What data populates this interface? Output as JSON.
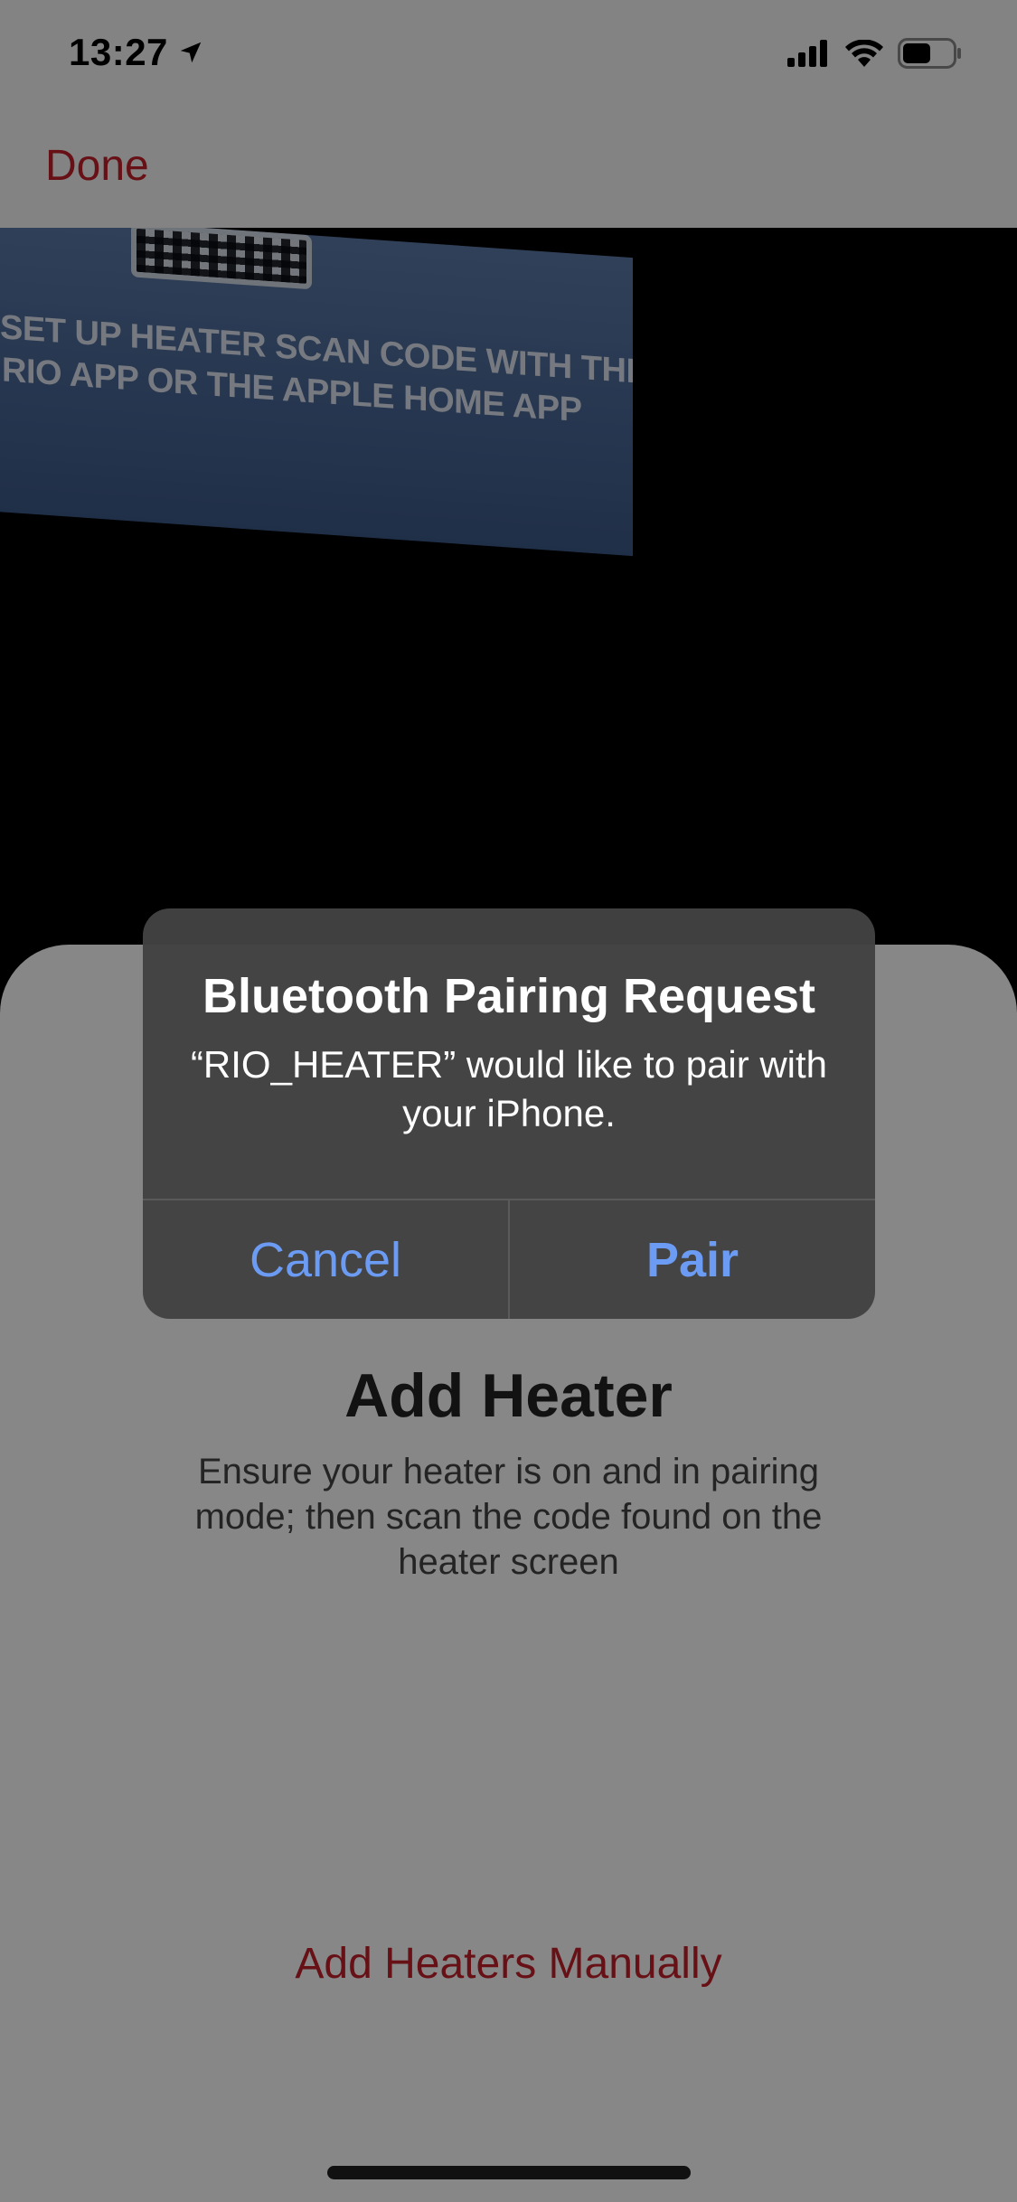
{
  "status_bar": {
    "time": "13:27",
    "location_icon": "location-arrow-icon",
    "signal_icon": "cellular-signal-icon",
    "wifi_icon": "wifi-icon",
    "battery_icon": "battery-icon"
  },
  "nav": {
    "done_label": "Done",
    "accent_color": "#c21f2a"
  },
  "camera_preview": {
    "text_line_1": "SET UP HEATER SCAN CODE WITH THE",
    "text_line_2": "RIO APP OR THE APPLE HOME APP"
  },
  "sheet": {
    "title": "Add Heater",
    "description": "Ensure your heater is on and in pairing mode; then scan the code found on the heater screen",
    "manual_link": "Add Heaters Manually"
  },
  "alert": {
    "title": "Bluetooth Pairing Request",
    "message": "“RIO_HEATER” would like to pair with your iPhone.",
    "cancel_label": "Cancel",
    "pair_label": "Pair",
    "button_color": "#6b9bf2"
  }
}
